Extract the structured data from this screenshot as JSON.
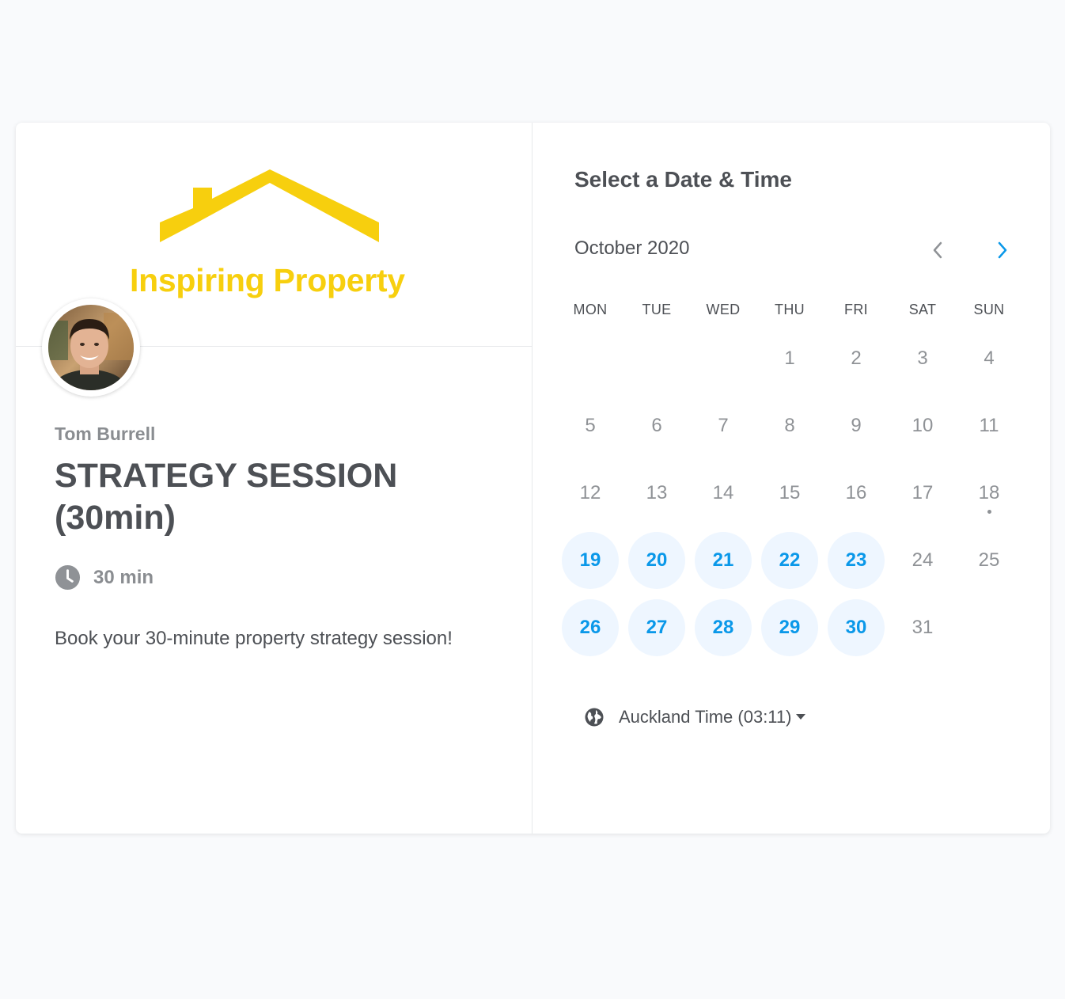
{
  "brand": {
    "name": "Inspiring Property",
    "color": "#f7cf0e",
    "logo_icon": "house-roof-icon"
  },
  "host": {
    "name": "Tom Burrell",
    "avatar_icon": "host-avatar"
  },
  "event": {
    "title": "STRATEGY SESSION (30min)",
    "duration": "30 min",
    "duration_icon": "clock-icon",
    "description": "Book your 30-minute property strategy session!"
  },
  "picker": {
    "title": "Select a Date & Time",
    "month": "October 2020",
    "prev_icon": "chevron-left-icon",
    "next_icon": "chevron-right-icon",
    "weekdays": [
      "MON",
      "TUE",
      "WED",
      "THU",
      "FRI",
      "SAT",
      "SUN"
    ],
    "weeks": [
      [
        {
          "d": ""
        },
        {
          "d": ""
        },
        {
          "d": ""
        },
        {
          "d": "1"
        },
        {
          "d": "2"
        },
        {
          "d": "3"
        },
        {
          "d": "4"
        }
      ],
      [
        {
          "d": "5"
        },
        {
          "d": "6"
        },
        {
          "d": "7"
        },
        {
          "d": "8"
        },
        {
          "d": "9"
        },
        {
          "d": "10"
        },
        {
          "d": "11"
        }
      ],
      [
        {
          "d": "12"
        },
        {
          "d": "13"
        },
        {
          "d": "14"
        },
        {
          "d": "15"
        },
        {
          "d": "16"
        },
        {
          "d": "17"
        },
        {
          "d": "18",
          "today": true
        }
      ],
      [
        {
          "d": "19",
          "available": true
        },
        {
          "d": "20",
          "available": true
        },
        {
          "d": "21",
          "available": true
        },
        {
          "d": "22",
          "available": true
        },
        {
          "d": "23",
          "available": true
        },
        {
          "d": "24"
        },
        {
          "d": "25"
        }
      ],
      [
        {
          "d": "26",
          "available": true
        },
        {
          "d": "27",
          "available": true
        },
        {
          "d": "28",
          "available": true
        },
        {
          "d": "29",
          "available": true
        },
        {
          "d": "30",
          "available": true
        },
        {
          "d": "31"
        },
        {
          "d": ""
        }
      ]
    ],
    "timezone": "Auckland Time (03:11)",
    "timezone_icon": "globe-icon"
  },
  "colors": {
    "accent": "#0a98e9",
    "available_bg": "#eef6ff",
    "text": "#4d5055",
    "muted": "#8a8d91"
  }
}
